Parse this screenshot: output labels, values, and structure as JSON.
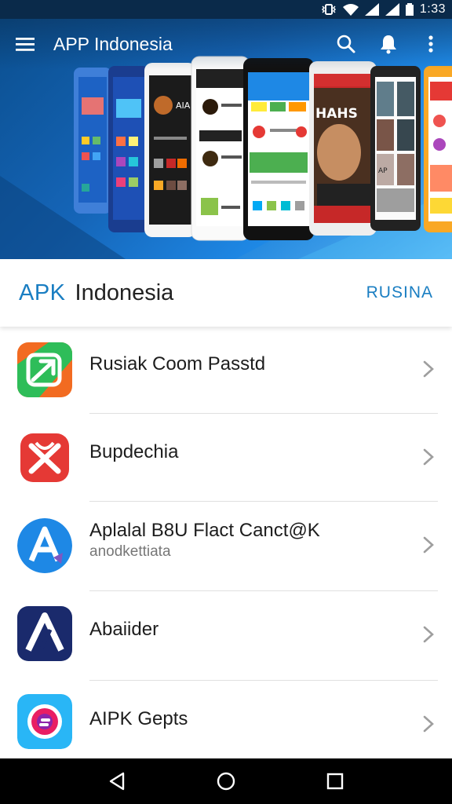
{
  "status_bar": {
    "time": "1:33"
  },
  "app_bar": {
    "title": "APP Indonesia",
    "menu_icon": "hamburger-menu-icon",
    "actions": [
      "search-icon",
      "notifications-bell-icon",
      "more-vert-icon"
    ]
  },
  "carousel": {
    "active_index": 1,
    "page_count": 2,
    "phones": [
      {
        "screen_text": ""
      },
      {
        "screen_text": ""
      },
      {
        "screen_text": "AIA"
      },
      {
        "screen_text": ""
      },
      {
        "screen_text": ""
      },
      {
        "screen_text": "HAHS"
      },
      {
        "screen_text": "AP"
      },
      {
        "screen_text": ""
      }
    ]
  },
  "section": {
    "prefix": "APK",
    "title": "Indonesia",
    "action": "RUSINA"
  },
  "apps": [
    {
      "name": "Rusiak Coom Passtd",
      "subtitle": "",
      "icon": "green-arrow-app-icon",
      "icon_color": "#f26b21"
    },
    {
      "name": "Bupdechia",
      "subtitle": "",
      "icon": "red-x-app-icon",
      "icon_color": "#e53935"
    },
    {
      "name": "Aplalal B8U Flact Canct@K",
      "subtitle": "anodkettiata",
      "icon": "blue-letter-a-app-icon",
      "icon_color": "#1e88e5"
    },
    {
      "name": "Abaiider",
      "subtitle": "",
      "icon": "dark-blue-a-app-icon",
      "icon_color": "#1a2a6c"
    },
    {
      "name": "AIPK Gepts",
      "subtitle": "",
      "icon": "pink-ring-app-icon",
      "icon_color": "#29b6f6"
    }
  ],
  "nav_bar": {
    "buttons": [
      "back-icon",
      "home-icon",
      "recents-icon"
    ]
  },
  "colors": {
    "accent": "#1a7ec2",
    "status_bar": "#0a2a4a",
    "nav_bar": "#000000"
  }
}
